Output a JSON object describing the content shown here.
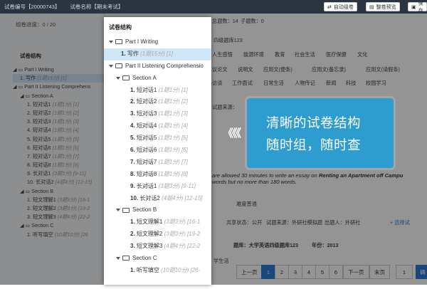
{
  "topbar": {
    "paper_no": "试卷编号【20000743】",
    "paper_name": "试卷名称【期末考试】",
    "btn_auto": "自动组卷",
    "btn_preview": "整卷预览",
    "btn_save": "保存"
  },
  "left": {
    "progress": "组卷进度：0 / 20",
    "title": "试卷结构",
    "items": [
      {
        "indent": 0,
        "text": "◢ ▭ Part I Writing",
        "meta": ""
      },
      {
        "indent": 1,
        "text": "1. 写作",
        "meta": "(1题15分) [1]",
        "selected": true
      },
      {
        "indent": 0,
        "text": "◢ ▭ Part II Listening Comprehens",
        "meta": ""
      },
      {
        "indent": 1,
        "text": "◢ ▭ Section A",
        "meta": ""
      },
      {
        "indent": 2,
        "text": "1. 短对话1",
        "meta": "(1题1分) [1]"
      },
      {
        "indent": 2,
        "text": "2. 短对话2",
        "meta": "(1题1分) [2]"
      },
      {
        "indent": 2,
        "text": "3. 短对话3",
        "meta": "(1题1分) [3]"
      },
      {
        "indent": 2,
        "text": "4. 短对话4",
        "meta": "(1题1分) [4]"
      },
      {
        "indent": 2,
        "text": "5. 短对话5",
        "meta": "(1题1分) [5]"
      },
      {
        "indent": 2,
        "text": "6. 短对话6",
        "meta": "(1题1分) [6]"
      },
      {
        "indent": 2,
        "text": "7. 短对话7",
        "meta": "(1题1分) [7]"
      },
      {
        "indent": 2,
        "text": "8. 短对话8",
        "meta": "(1题1分) [8]"
      },
      {
        "indent": 2,
        "text": "9. 长对话1",
        "meta": "(3题3分) [9-11]"
      },
      {
        "indent": 2,
        "text": "10. 长对话2",
        "meta": "(4题4分) [12-15]"
      },
      {
        "indent": 1,
        "text": "◢ ▭ Section B",
        "meta": ""
      },
      {
        "indent": 2,
        "text": "1. 短文理解1",
        "meta": "(3题3分) [16-1"
      },
      {
        "indent": 2,
        "text": "2. 短文理解2",
        "meta": "(3题3分) [19-2"
      },
      {
        "indent": 2,
        "text": "3. 短文理解3",
        "meta": "(4题4分) [22-2"
      },
      {
        "indent": 1,
        "text": "◢ ▭ Section C",
        "meta": ""
      },
      {
        "indent": 2,
        "text": "1. 听写填空",
        "meta": "(10题10分) [26"
      }
    ]
  },
  "main": {
    "count_label": "总题数：14",
    "subcount_label": "子题数：0",
    "bank_label": "四级题库123",
    "tags_row1": [
      "人生感悟",
      "能源环境",
      "教育",
      "社会生活",
      "医疗保健",
      "文化"
    ],
    "tags_row2": [
      "议论文",
      "说明文",
      "应用文(便条)",
      "应用文(备忘录)",
      "应用文(请假条)"
    ],
    "tags_row3": [
      "访谈",
      "工作面试",
      "日常生活",
      "人物传记",
      "新闻",
      "科技",
      "校园学习"
    ],
    "source_label": "试题来源：",
    "essay_line1_a": "are allowed 30 minutes to write an essay on",
    "essay_line1_b": "Renting an Apartment off Campu",
    "essay_line2": "words but no more than 180 words.",
    "difficulty": "难度普通",
    "share_status": "共享状态：公开",
    "source_mock": "试题来源：外研社模拟题",
    "author": "出题人：外研社",
    "select_label": "+ 选择试",
    "bank_full": "题库：大学英语四级题库123",
    "year": "年份：2013",
    "subject": "学生活",
    "prev_page": "上一页",
    "next_page": "下一页",
    "last_page": "末页",
    "pages": [
      "1",
      "2",
      "3",
      "4",
      "5",
      "6"
    ],
    "current_page_input": "1",
    "go_label": "确"
  },
  "popup": {
    "title": "试卷结构",
    "rows": [
      {
        "level": 0,
        "type": "group",
        "label": "Part I Writing",
        "meta": ""
      },
      {
        "level": 1,
        "type": "item",
        "num": "1.",
        "label": "写作",
        "meta": "(1题15分) [1]",
        "selected": true
      },
      {
        "level": 0,
        "type": "group",
        "label": "Part II Listening Comprehensio",
        "meta": ""
      },
      {
        "level": 1,
        "type": "group",
        "label": "Section A",
        "meta": ""
      },
      {
        "level": 2,
        "type": "item",
        "num": "1.",
        "label": "短对话1",
        "meta": "(1题1分) [1]"
      },
      {
        "level": 2,
        "type": "item",
        "num": "2.",
        "label": "短对话2",
        "meta": "(1题1分) [2]"
      },
      {
        "level": 2,
        "type": "item",
        "num": "3.",
        "label": "短对话3",
        "meta": "(1题1分) [3]"
      },
      {
        "level": 2,
        "type": "item",
        "num": "4.",
        "label": "短对话4",
        "meta": "(1题1分) [4]"
      },
      {
        "level": 2,
        "type": "item",
        "num": "5.",
        "label": "短对话5",
        "meta": "(1题1分) [5]"
      },
      {
        "level": 2,
        "type": "item",
        "num": "6.",
        "label": "短对话6",
        "meta": "(1题1分) [6]"
      },
      {
        "level": 2,
        "type": "item",
        "num": "7.",
        "label": "短对话7",
        "meta": "(1题1分) [7]"
      },
      {
        "level": 2,
        "type": "item",
        "num": "8.",
        "label": "短对话8",
        "meta": "(1题1分) [8]"
      },
      {
        "level": 2,
        "type": "item",
        "num": "9.",
        "label": "长对话1",
        "meta": "(3题3分) [9-11]"
      },
      {
        "level": 2,
        "type": "item",
        "num": "10.",
        "label": "长对话2",
        "meta": "(4题4分) [12-15]"
      },
      {
        "level": 1,
        "type": "group",
        "label": "Section B",
        "meta": ""
      },
      {
        "level": 2,
        "type": "item",
        "num": "1.",
        "label": "短文理解1",
        "meta": "(3题3分) [16-1"
      },
      {
        "level": 2,
        "type": "item",
        "num": "2.",
        "label": "短文理解2",
        "meta": "(3题3分) [19-2"
      },
      {
        "level": 2,
        "type": "item",
        "num": "3.",
        "label": "短文理解3",
        "meta": "(4题4分) [22-2"
      },
      {
        "level": 1,
        "type": "group",
        "label": "Section C",
        "meta": ""
      },
      {
        "level": 2,
        "type": "item",
        "num": "1.",
        "label": "听写填空",
        "meta": "(10题10分) [26-"
      },
      {
        "level": 2,
        "type": "item",
        "num": "",
        "label": "",
        "meta": ""
      }
    ]
  },
  "callout": {
    "line1": "清晰的试卷结构",
    "line2": "随时组，随时查",
    "arrows": "《《《"
  },
  "colors": {
    "topbar": "#2b3541",
    "callout": "#2d9ccf",
    "selected_row": "#cfe6f7",
    "page_active": "#2b7bd6"
  }
}
